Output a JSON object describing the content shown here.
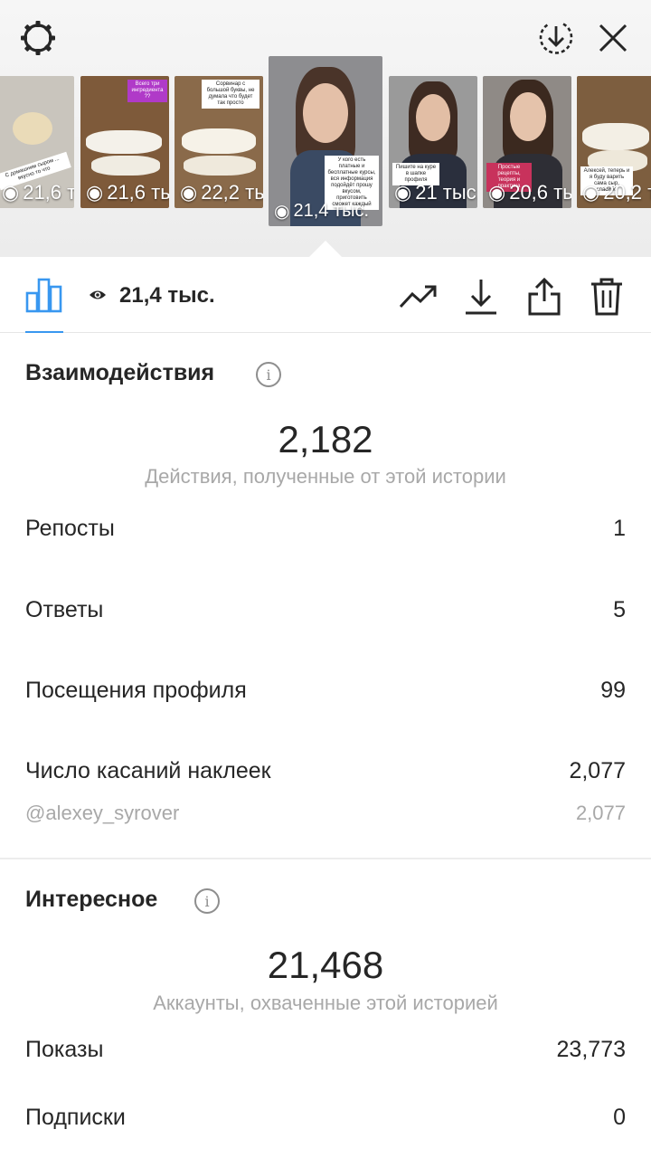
{
  "colors": {
    "accent": "#3897f0",
    "text": "#262626",
    "secondary": "#a8a8a8"
  },
  "top_icons": [
    "gear-icon",
    "download-circle-icon",
    "close-icon"
  ],
  "stories": [
    {
      "views": "21,6 тыс.",
      "caption": "С домашним сыром ... вкусно то что"
    },
    {
      "views": "21,6 тыс.",
      "caption": "Всего три ингредиента ??"
    },
    {
      "views": "22,2 тыс.",
      "caption": "Сорвинар с большой буквы, не думала что будет так просто",
      "tag": "@alexey_syrover"
    },
    {
      "views": "21,4 тыс.",
      "caption": "У кого есть платные и бесплатные курсы, вся информация подойдёт прошу вкусом, приготовить сможет каждый"
    },
    {
      "views": "21 тыс.",
      "caption": "Пишите на куре в шапке профиля",
      "tag": "@alexey_syrover"
    },
    {
      "views": "20,6 тыс.",
      "caption": "Простые рецепты, теория и практика"
    },
    {
      "views": "20,2 тыс.",
      "caption": "Алексей, теперь и я буду варить сама сыр, спасибо"
    }
  ],
  "toolbar": {
    "views": "21,4 тыс.",
    "icons": [
      "bar-chart-icon",
      "eye-icon",
      "trend-icon",
      "download-icon",
      "share-icon",
      "trash-icon"
    ]
  },
  "interactions": {
    "title": "Взаимодействия",
    "total": "2,182",
    "caption": "Действия, полученные от этой истории",
    "rows": [
      {
        "label": "Репосты",
        "value": "1"
      },
      {
        "label": "Ответы",
        "value": "5"
      },
      {
        "label": "Посещения профиля",
        "value": "99"
      },
      {
        "label": "Число касаний наклеек",
        "value": "2,077"
      }
    ],
    "sticker": {
      "label": "@alexey_syrover",
      "value": "2,077"
    }
  },
  "discovery": {
    "title": "Интересное",
    "total": "21,468",
    "caption": "Аккаунты, охваченные этой историей",
    "rows": [
      {
        "label": "Показы",
        "value": "23,773"
      },
      {
        "label": "Подписки",
        "value": "0"
      }
    ]
  }
}
